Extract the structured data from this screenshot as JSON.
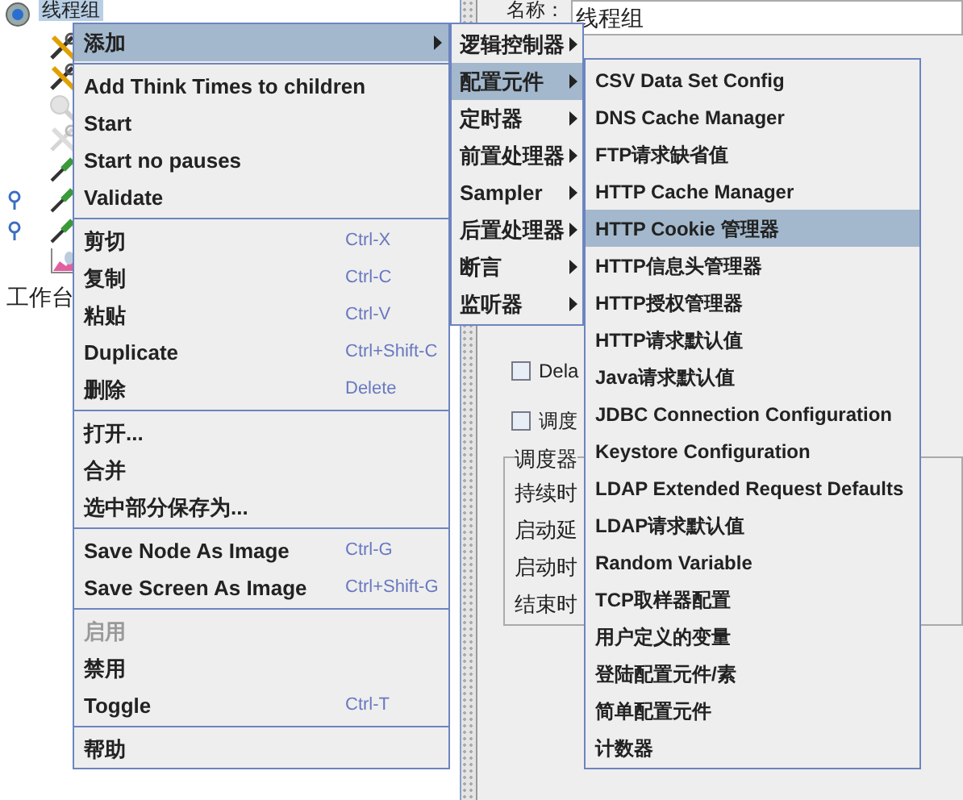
{
  "tree": {
    "root": {
      "label": "线程组",
      "selected": true
    },
    "children": [
      {
        "kind": "tools",
        "disabled": false,
        "expanded": false
      },
      {
        "kind": "tools",
        "disabled": false,
        "expanded": false
      },
      {
        "kind": "magnifier",
        "disabled": true,
        "expanded": false
      },
      {
        "kind": "tools",
        "disabled": true,
        "expanded": false
      },
      {
        "kind": "pipette",
        "disabled": false,
        "expanded": false
      },
      {
        "kind": "pipette",
        "disabled": false,
        "expanded": true
      },
      {
        "kind": "pipette",
        "disabled": false,
        "expanded": true
      },
      {
        "kind": "chart",
        "disabled": false,
        "expanded": false
      }
    ],
    "workbench": "工作台"
  },
  "editor": {
    "name_label": "名称：",
    "name_value": "线程组",
    "checkboxes": [
      {
        "label": "Dela",
        "checked": false
      },
      {
        "label": "调度",
        "checked": false
      }
    ],
    "scheduler": {
      "title": "调度器",
      "fields": [
        "持续时",
        "启动延",
        "启动时",
        "结束时"
      ]
    }
  },
  "context_menu": {
    "sections": [
      [
        {
          "label": "添加",
          "has_submenu": true,
          "selected": true,
          "disabled": false
        }
      ],
      [
        {
          "label": "Add Think Times to children",
          "has_submenu": false,
          "selected": false,
          "disabled": false
        },
        {
          "label": "Start",
          "has_submenu": false,
          "selected": false,
          "disabled": false
        },
        {
          "label": "Start no pauses",
          "has_submenu": false,
          "selected": false,
          "disabled": false
        },
        {
          "label": "Validate",
          "has_submenu": false,
          "selected": false,
          "disabled": false
        }
      ],
      [
        {
          "label": "剪切",
          "shortcut": "Ctrl-X",
          "has_submenu": false,
          "selected": false,
          "disabled": false
        },
        {
          "label": "复制",
          "shortcut": "Ctrl-C",
          "has_submenu": false,
          "selected": false,
          "disabled": false
        },
        {
          "label": "粘贴",
          "shortcut": "Ctrl-V",
          "has_submenu": false,
          "selected": false,
          "disabled": false
        },
        {
          "label": "Duplicate",
          "shortcut": "Ctrl+Shift-C",
          "has_submenu": false,
          "selected": false,
          "disabled": false
        },
        {
          "label": "删除",
          "shortcut": "Delete",
          "has_submenu": false,
          "selected": false,
          "disabled": false
        }
      ],
      [
        {
          "label": "打开...",
          "has_submenu": false,
          "selected": false,
          "disabled": false
        },
        {
          "label": "合并",
          "has_submenu": false,
          "selected": false,
          "disabled": false
        },
        {
          "label": "选中部分保存为...",
          "has_submenu": false,
          "selected": false,
          "disabled": false
        }
      ],
      [
        {
          "label": "Save Node As Image",
          "shortcut": "Ctrl-G",
          "has_submenu": false,
          "selected": false,
          "disabled": false
        },
        {
          "label": "Save Screen As Image",
          "shortcut": "Ctrl+Shift-G",
          "has_submenu": false,
          "selected": false,
          "disabled": false
        }
      ],
      [
        {
          "label": "启用",
          "has_submenu": false,
          "selected": false,
          "disabled": true
        },
        {
          "label": "禁用",
          "has_submenu": false,
          "selected": false,
          "disabled": false
        },
        {
          "label": "Toggle",
          "shortcut": "Ctrl-T",
          "has_submenu": false,
          "selected": false,
          "disabled": false
        }
      ],
      [
        {
          "label": "帮助",
          "has_submenu": false,
          "selected": false,
          "disabled": false
        }
      ]
    ]
  },
  "add_submenu": {
    "items": [
      {
        "label": "逻辑控制器",
        "selected": false
      },
      {
        "label": "配置元件",
        "selected": true
      },
      {
        "label": "定时器",
        "selected": false
      },
      {
        "label": "前置处理器",
        "selected": false
      },
      {
        "label": "Sampler",
        "selected": false
      },
      {
        "label": "后置处理器",
        "selected": false
      },
      {
        "label": "断言",
        "selected": false
      },
      {
        "label": "监听器",
        "selected": false
      }
    ]
  },
  "config_submenu": {
    "items": [
      {
        "label": "CSV Data Set Config",
        "selected": false
      },
      {
        "label": "DNS Cache Manager",
        "selected": false
      },
      {
        "label": "FTP请求缺省值",
        "selected": false
      },
      {
        "label": "HTTP Cache Manager",
        "selected": false
      },
      {
        "label": "HTTP Cookie 管理器",
        "selected": true
      },
      {
        "label": "HTTP信息头管理器",
        "selected": false
      },
      {
        "label": "HTTP授权管理器",
        "selected": false
      },
      {
        "label": "HTTP请求默认值",
        "selected": false
      },
      {
        "label": "Java请求默认值",
        "selected": false
      },
      {
        "label": "JDBC Connection Configuration",
        "selected": false
      },
      {
        "label": "Keystore Configuration",
        "selected": false
      },
      {
        "label": "LDAP Extended Request Defaults",
        "selected": false
      },
      {
        "label": "LDAP请求默认值",
        "selected": false
      },
      {
        "label": "Random Variable",
        "selected": false
      },
      {
        "label": "TCP取样器配置",
        "selected": false
      },
      {
        "label": "用户定义的变量",
        "selected": false
      },
      {
        "label": "登陆配置元件/素",
        "selected": false
      },
      {
        "label": "简单配置元件",
        "selected": false
      },
      {
        "label": "计数器",
        "selected": false
      }
    ]
  }
}
